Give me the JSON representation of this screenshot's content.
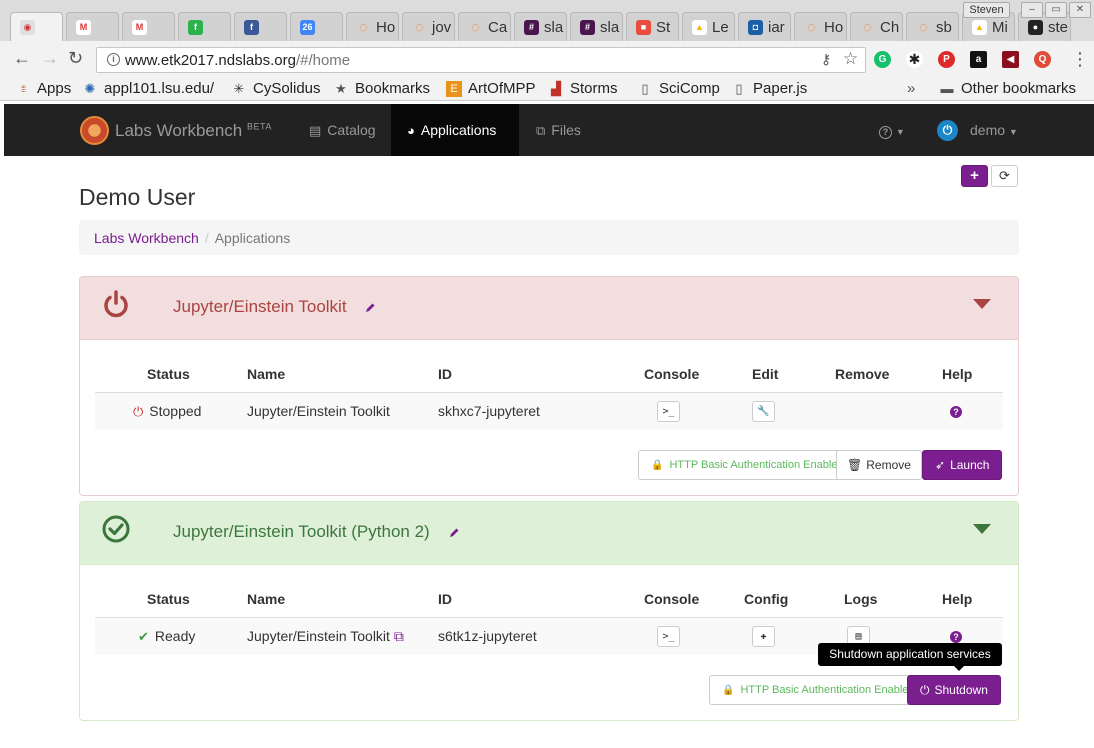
{
  "browser": {
    "tabs": [
      {
        "title": "",
        "icon": "chrome-icon"
      },
      {
        "title": "",
        "icon": "gmail-icon"
      },
      {
        "title": "",
        "icon": "gmail-icon"
      },
      {
        "title": "",
        "icon": "feedly-icon"
      },
      {
        "title": "",
        "icon": "facebook-icon"
      },
      {
        "title": "",
        "icon": "calendar-icon",
        "badge": "26"
      },
      {
        "title": "Ho",
        "icon": "jupyter-icon"
      },
      {
        "title": "jov",
        "icon": "jupyter-icon"
      },
      {
        "title": "Ca",
        "icon": "jupyter-icon"
      },
      {
        "title": "sla",
        "icon": "slack-icon"
      },
      {
        "title": "sla",
        "icon": "slack-icon"
      },
      {
        "title": "St",
        "icon": "site-icon"
      },
      {
        "title": "Le",
        "icon": "drive-icon"
      },
      {
        "title": "iar",
        "icon": "shield-icon"
      },
      {
        "title": "Ho",
        "icon": "jupyter-icon"
      },
      {
        "title": "Ch",
        "icon": "jupyter-icon"
      },
      {
        "title": "sb",
        "icon": "jupyter-icon"
      },
      {
        "title": "Mi",
        "icon": "drive-icon"
      },
      {
        "title": "ste",
        "icon": "github-icon"
      }
    ],
    "profile": "Steven",
    "url_host": "www.etk2017.ndslabs.org",
    "url_path": "/#/home",
    "bookmarks": [
      {
        "label": "Apps",
        "icon": "apps-grid-icon"
      },
      {
        "label": "appl101.lsu.edu/",
        "icon": "tiger-icon"
      },
      {
        "label": "CySolidus",
        "icon": "cysolidus-icon"
      },
      {
        "label": "Bookmarks",
        "icon": "star-icon"
      },
      {
        "label": "ArtOfMPP",
        "icon": "artofmpp-icon"
      },
      {
        "label": "Storms",
        "icon": "storms-icon"
      },
      {
        "label": "SciComp",
        "icon": "page-icon"
      },
      {
        "label": "Paper.js",
        "icon": "page-icon"
      }
    ],
    "bookmarks_overflow": "»",
    "other_bookmarks": "Other bookmarks"
  },
  "navbar": {
    "brand": "Labs Workbench",
    "brand_tag": "BETA",
    "links": [
      {
        "label": "Catalog",
        "icon": "catalog-icon"
      },
      {
        "label": "Applications",
        "icon": "dashboard-icon"
      },
      {
        "label": "Files",
        "icon": "files-icon"
      }
    ],
    "help": "?",
    "user": "demo"
  },
  "page": {
    "title": "Demo User",
    "breadcrumb": {
      "home": "Labs Workbench",
      "current": "Applications"
    },
    "add_label": "+",
    "refresh_label": "⟳"
  },
  "apps": [
    {
      "name": "Jupyter/Einstein Toolkit",
      "state": "stopped",
      "columns": [
        "Status",
        "Name",
        "ID",
        "Console",
        "Edit",
        "Remove",
        "Help"
      ],
      "row": {
        "status": "Stopped",
        "name": "Jupyter/Einstein Toolkit",
        "id": "skhxc7-jupyteret"
      },
      "auth_label": "HTTP Basic Authentication Enabled",
      "remove_label": "Remove",
      "action_label": "Launch"
    },
    {
      "name": "Jupyter/Einstein Toolkit (Python 2)",
      "state": "ready",
      "columns": [
        "Status",
        "Name",
        "ID",
        "Console",
        "Config",
        "Logs",
        "Help"
      ],
      "row": {
        "status": "Ready",
        "name": "Jupyter/Einstein Toolkit",
        "id": "s6tk1z-jupyteret"
      },
      "auth_label": "HTTP Basic Authentication Enabled",
      "action_label": "Shutdown",
      "tooltip": "Shutdown application services"
    }
  ],
  "colors": {
    "brand_purple": "#7b1e8f",
    "danger": "#a94442",
    "success": "#3c763d",
    "navbar_bg": "#222222"
  }
}
